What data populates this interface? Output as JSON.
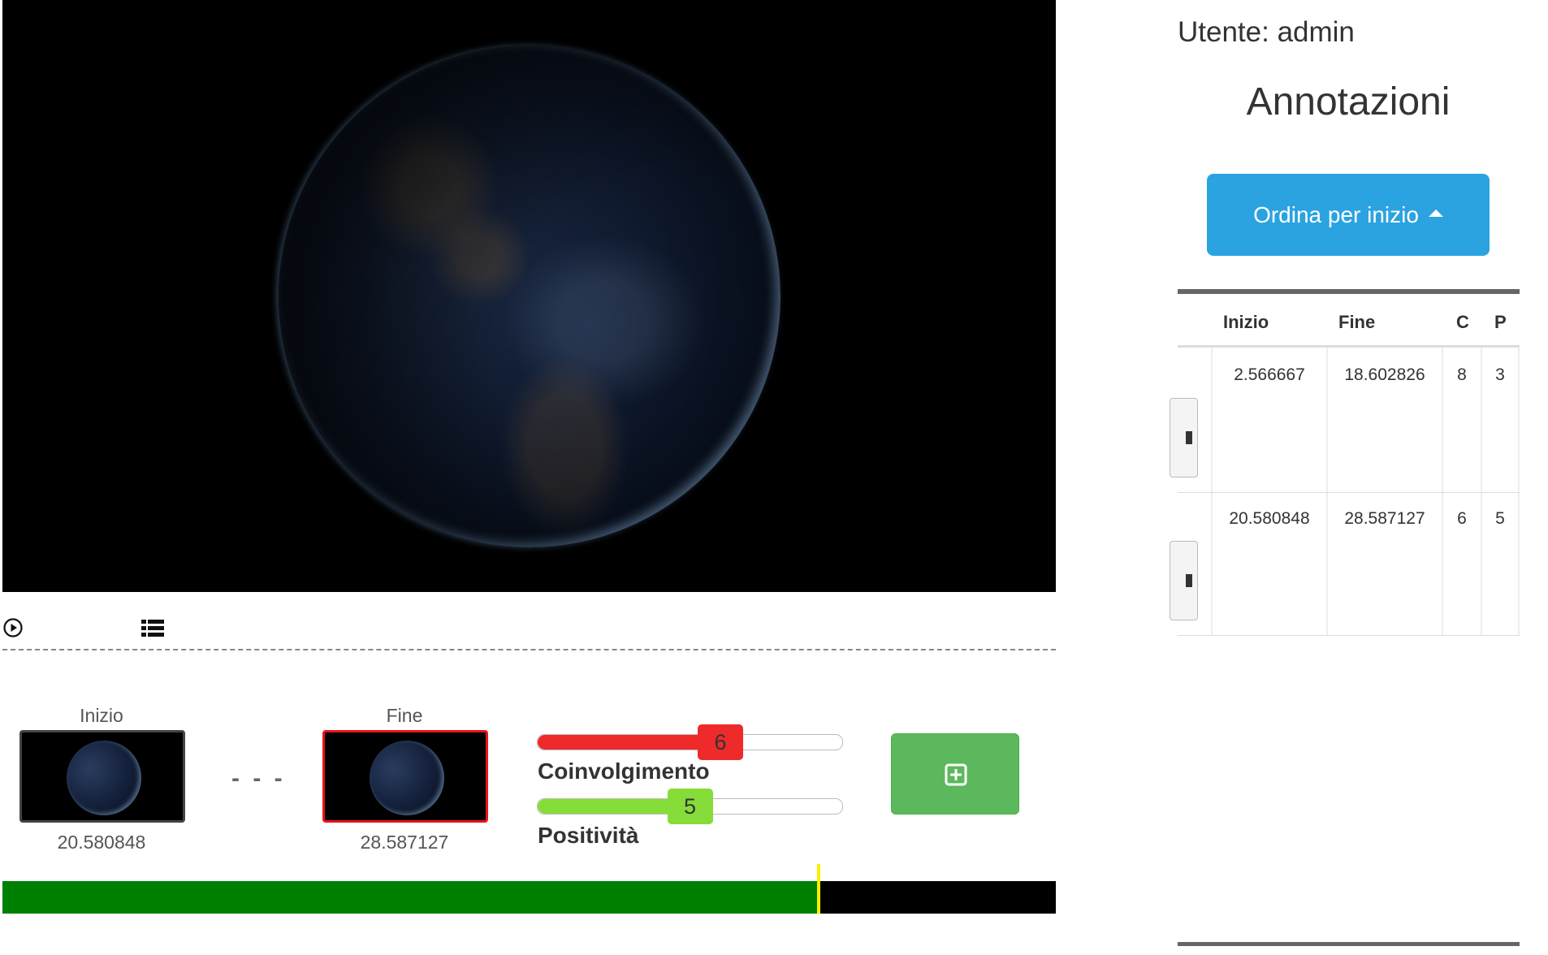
{
  "video": {
    "description_hidden": ""
  },
  "controls": {
    "play_icon": "play-circle-icon",
    "list_icon": "list-icon"
  },
  "clip": {
    "start_label": "Inizio",
    "end_label": "Fine",
    "start_time": "20.580848",
    "end_time": "28.587127",
    "separator": "- - -"
  },
  "sliders": {
    "coinvolgimento": {
      "label": "Coinvolgimento",
      "value": "6",
      "fraction": 0.6,
      "color": "#ee2a2a"
    },
    "positivita": {
      "label": "Positività",
      "value": "5",
      "fraction": 0.5,
      "color": "#86dd3a"
    }
  },
  "add_button": {
    "icon": "plus-square-icon",
    "color": "#5cb85c"
  },
  "timeline": {
    "progress_fraction": 0.773,
    "fill_color": "#008000",
    "cursor_color": "#ffee00"
  },
  "panel": {
    "user": "Utente: admin",
    "title": "Annotazioni",
    "sort_button": "Ordina per inizio",
    "sort_color": "#2aa3e0",
    "table": {
      "headers": [
        "Inizio",
        "Fine",
        "C",
        "P"
      ],
      "rows": [
        [
          "2.566667",
          "18.602826",
          "8",
          "3"
        ],
        [
          "20.580848",
          "28.587127",
          "6",
          "5"
        ]
      ]
    }
  }
}
